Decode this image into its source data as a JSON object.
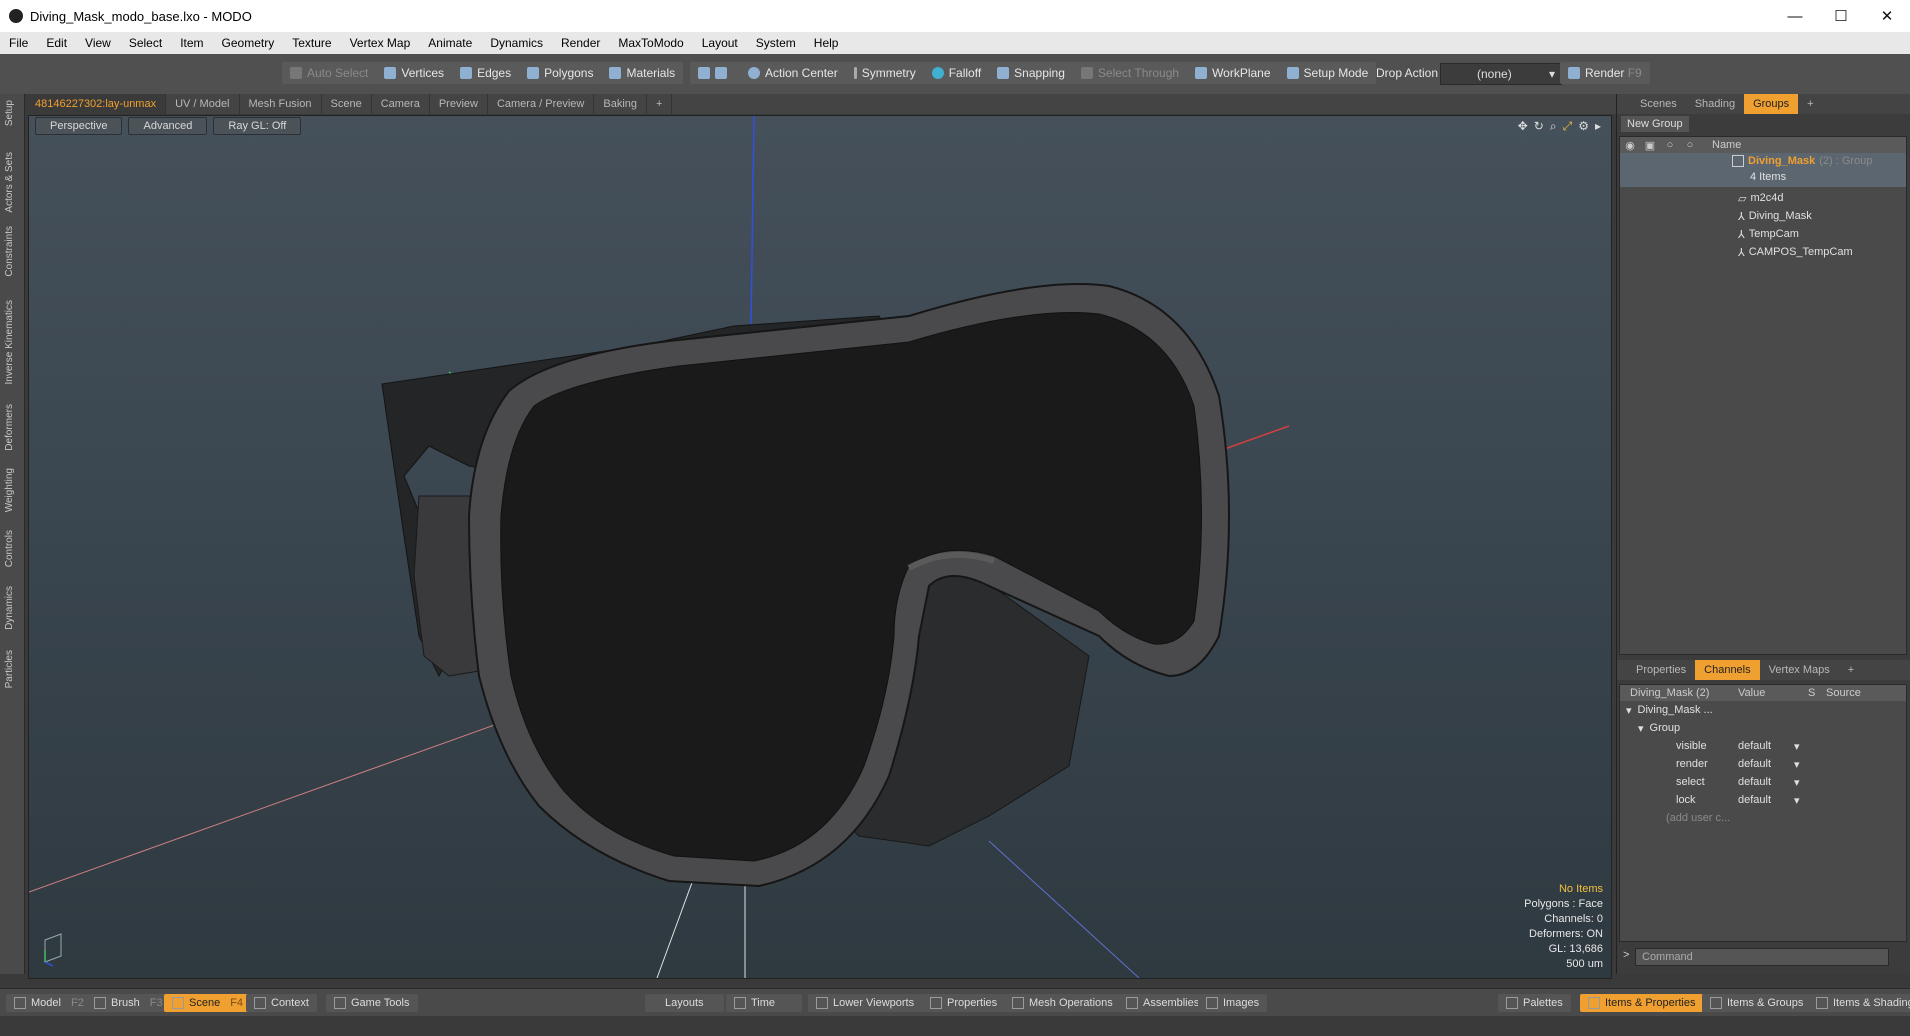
{
  "window": {
    "title": "Diving_Mask_modo_base.lxo - MODO",
    "minimize": "—",
    "maximize": "☐",
    "close": "✕"
  },
  "menu": [
    "File",
    "Edit",
    "View",
    "Select",
    "Item",
    "Geometry",
    "Texture",
    "Vertex Map",
    "Animate",
    "Dynamics",
    "Render",
    "MaxToModo",
    "Layout",
    "System",
    "Help"
  ],
  "toolbar": {
    "auto_select": "Auto Select",
    "vertices": "Vertices",
    "edges": "Edges",
    "polygons": "Polygons",
    "materials": "Materials",
    "action_center": "Action Center",
    "symmetry": "Symmetry",
    "falloff": "Falloff",
    "snapping": "Snapping",
    "select_through": "Select Through",
    "workplane": "WorkPlane",
    "setup_mode": "Setup Mode",
    "drop_action": "Drop Action",
    "drop_value": "(none)",
    "render": "Render",
    "render_key": "F9"
  },
  "left_tabs": [
    "Setup",
    "Actors & Sets",
    "Constraints",
    "Inverse Kinematics",
    "Deformers",
    "Weighting",
    "Controls",
    "Dynamics",
    "Particles"
  ],
  "viewport_tabs": [
    "48146227302:lay-unmax",
    "UV / Model",
    "Mesh Fusion",
    "Scene",
    "Camera",
    "Preview",
    "Camera / Preview",
    "Baking",
    "+"
  ],
  "viewport": {
    "view": "Perspective",
    "shading": "Advanced",
    "raygl": "Ray GL: Off",
    "info": {
      "items": "No Items",
      "polygons": "Polygons : Face",
      "channels": "Channels: 0",
      "deformers": "Deformers: ON",
      "gl": "GL: 13,686",
      "scale": "500 um"
    }
  },
  "scene_tabs": [
    "Scenes",
    "Shading",
    "Groups",
    "+"
  ],
  "groups": {
    "new_group": "New Group",
    "col_name": "Name",
    "group_name": "Diving_Mask",
    "group_suffix": "(2) : Group",
    "group_count": "4 Items",
    "items": [
      "m2c4d",
      "Diving_Mask",
      "TempCam",
      "CAMPOS_TempCam"
    ]
  },
  "props_tabs": [
    "Properties",
    "Channels",
    "Vertex Maps",
    "+"
  ],
  "channels": {
    "col_item": "Diving_Mask (2)",
    "col_value": "Value",
    "col_s": "S",
    "col_source": "Source",
    "root": "Diving_Mask ...",
    "sub": "Group",
    "rows": [
      {
        "name": "visible",
        "value": "default"
      },
      {
        "name": "render",
        "value": "default"
      },
      {
        "name": "select",
        "value": "default"
      },
      {
        "name": "lock",
        "value": "default"
      }
    ],
    "add_user": "(add user c..."
  },
  "command": {
    "prompt": ">",
    "placeholder": "Command"
  },
  "bottom": {
    "model": "Model",
    "model_key": "F2",
    "brush": "Brush",
    "brush_key": "F3",
    "scene": "Scene",
    "scene_key": "F4",
    "context": "Context",
    "game_tools": "Game Tools",
    "layouts": "Layouts",
    "time": "Time",
    "lower_viewports": "Lower Viewports",
    "properties": "Properties",
    "mesh_operations": "Mesh Operations",
    "assemblies": "Assemblies",
    "images": "Images",
    "palettes": "Palettes",
    "items_properties": "Items & Properties",
    "items_groups": "Items & Groups",
    "items_shading": "Items & Shading"
  },
  "colors": {
    "accent": "#f0a030",
    "x_axis": "#d04040",
    "y_axis": "#40c060",
    "z_axis": "#3050e0"
  }
}
